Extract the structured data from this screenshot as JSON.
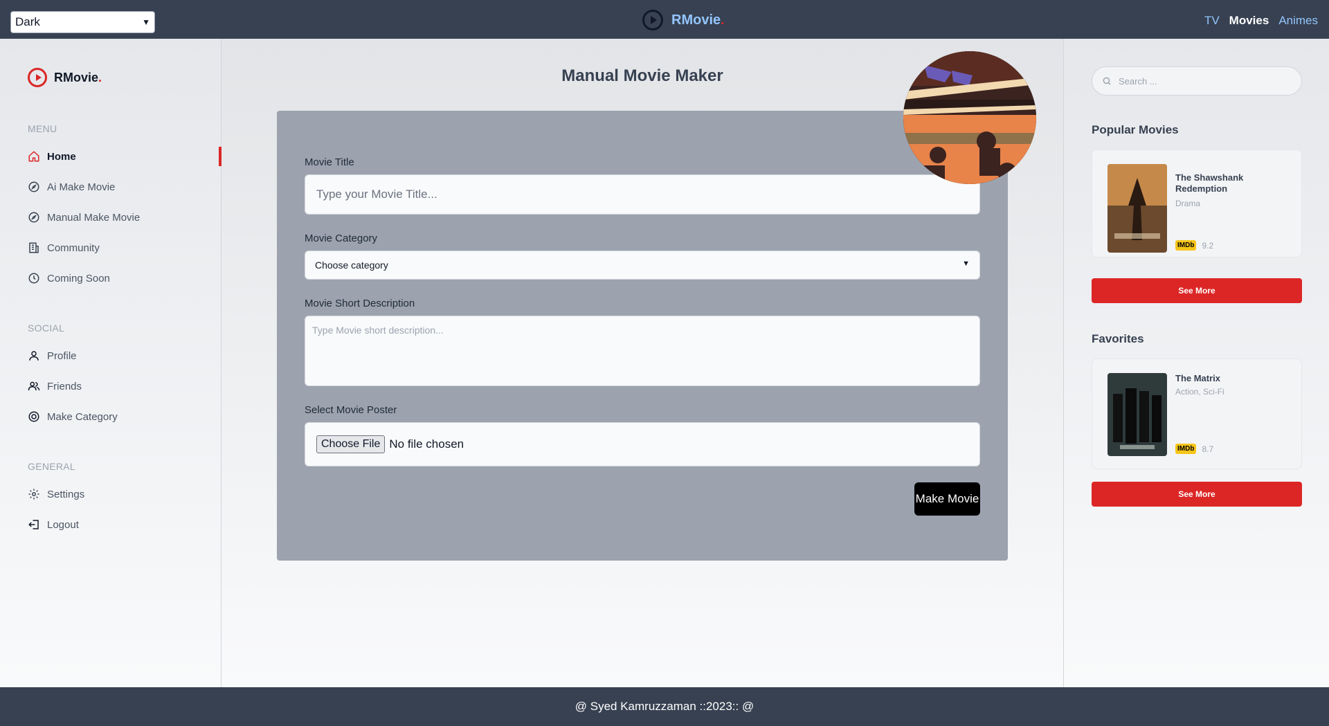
{
  "topbar": {
    "theme_value": "Dark",
    "brand": "RMovie",
    "brand_dot": ".",
    "nav": {
      "tv": "TV",
      "movies": "Movies",
      "animes": "Animes"
    }
  },
  "sidebar": {
    "brand": "RMovie",
    "brand_dot": ".",
    "menu_label": "MENU",
    "menu": [
      {
        "label": "Home",
        "icon": "home-icon"
      },
      {
        "label": "Ai Make Movie",
        "icon": "compass-icon"
      },
      {
        "label": "Manual Make Movie",
        "icon": "compass-icon"
      },
      {
        "label": "Community",
        "icon": "building-icon"
      },
      {
        "label": "Coming Soon",
        "icon": "clock-icon"
      }
    ],
    "social_label": "SOCIAL",
    "social": [
      {
        "label": "Profile",
        "icon": "user-icon"
      },
      {
        "label": "Friends",
        "icon": "users-icon"
      },
      {
        "label": "Make Category",
        "icon": "target-icon"
      }
    ],
    "general_label": "GENERAL",
    "general": [
      {
        "label": "Settings",
        "icon": "gear-icon"
      },
      {
        "label": "Logout",
        "icon": "logout-icon"
      }
    ]
  },
  "main": {
    "title": "Manual Movie Maker",
    "form": {
      "title_label": "Movie Title",
      "title_placeholder": "Type your Movie Title...",
      "category_label": "Movie Category",
      "category_value": "Choose category",
      "desc_label": "Movie Short Description",
      "desc_placeholder": "Type Movie short description...",
      "poster_label": "Select Movie Poster",
      "choose_file": "Choose File",
      "no_file": "No file chosen",
      "submit": "Make Movie"
    }
  },
  "right": {
    "search_placeholder": "Search ...",
    "popular_title": "Popular Movies",
    "popular": {
      "title": "The Shawshank Redemption",
      "genre": "Drama",
      "imdb_label": "IMDb",
      "rating": "9.2"
    },
    "favorites_title": "Favorites",
    "favorite": {
      "title": "The Matrix",
      "genre": "Action, Sci-Fi",
      "imdb_label": "IMDb",
      "rating": "8.7"
    },
    "see_more": "See More"
  },
  "footer": {
    "text": "@ Syed Kamruzzaman ::2023:: @"
  },
  "colors": {
    "accent": "#dc2626",
    "bar": "#374151",
    "link": "#93c5fd"
  }
}
